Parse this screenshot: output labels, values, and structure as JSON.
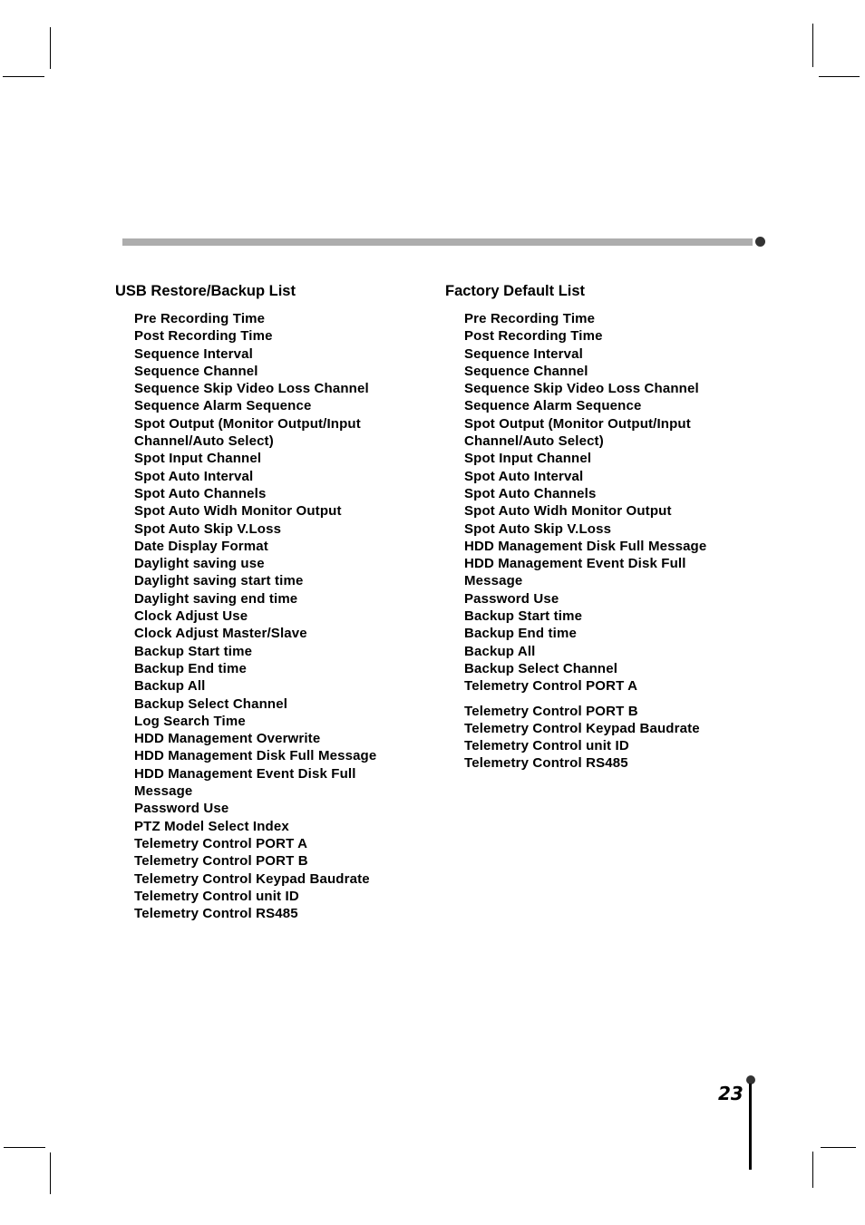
{
  "page": {
    "page_number": "23"
  },
  "left_column": {
    "title": "USB Restore/Backup List",
    "items": [
      "Pre Recording Time",
      "Post Recording Time",
      "Sequence Interval",
      "Sequence Channel",
      "Sequence Skip Video Loss Channel",
      "Sequence Alarm Sequence",
      "Spot Output (Monitor Output/Input",
      "Channel/Auto Select)",
      "Spot Input Channel",
      "Spot Auto Interval",
      "Spot Auto Channels",
      "Spot Auto Widh Monitor Output",
      "Spot Auto Skip V.Loss",
      "Date Display Format",
      "Daylight saving use",
      "Daylight saving start time",
      "Daylight saving end time",
      "Clock Adjust Use",
      "Clock Adjust Master/Slave",
      "Backup Start time",
      "Backup End time",
      "Backup All",
      "Backup Select Channel",
      "Log Search Time",
      "HDD Management Overwrite",
      "HDD Management Disk Full Message",
      "HDD Management Event Disk Full",
      "Message",
      "Password Use",
      "PTZ Model Select Index",
      "Telemetry Control PORT A",
      "Telemetry Control PORT B",
      "Telemetry Control Keypad Baudrate",
      "Telemetry Control unit ID",
      "Telemetry Control RS485"
    ]
  },
  "right_column": {
    "title": "Factory Default List",
    "items": [
      "Pre Recording Time",
      "Post Recording Time",
      "Sequence Interval",
      "Sequence Channel",
      "Sequence Skip Video Loss Channel",
      "Sequence Alarm Sequence",
      "Spot Output (Monitor Output/Input",
      "Channel/Auto Select)",
      "Spot Input Channel",
      "Spot Auto Interval",
      "Spot Auto Channels",
      "Spot Auto Widh Monitor Output",
      "Spot Auto Skip V.Loss",
      "HDD Management Disk Full Message",
      "HDD Management Event Disk Full",
      "Message",
      "Password Use",
      "Backup Start time",
      "Backup End time",
      "Backup All",
      "Backup Select Channel",
      "Telemetry Control PORT A",
      "Telemetry Control PORT B",
      "Telemetry Control Keypad Baudrate",
      "Telemetry Control unit ID",
      "Telemetry Control RS485"
    ]
  }
}
